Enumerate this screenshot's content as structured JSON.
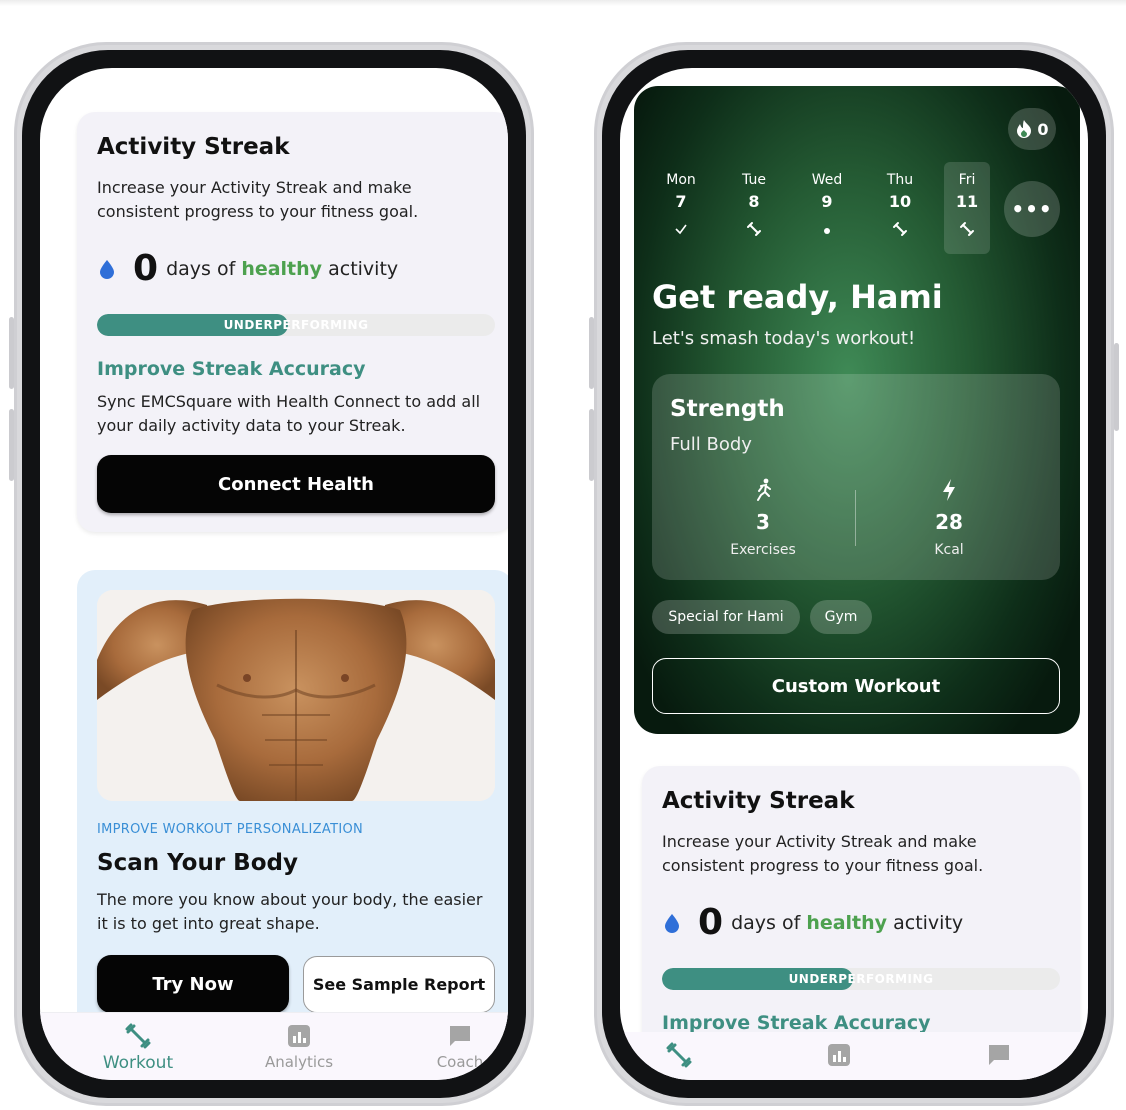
{
  "left": {
    "streak": {
      "title": "Activity Streak",
      "description": "Increase your Activity Streak and make consistent progress to your fitness goal.",
      "count": "0",
      "text_before": "days of",
      "text_highlight": "healthy",
      "text_after": "activity",
      "progress_label": "UNDERPERFORMING",
      "progress_fraction": 0.48,
      "improve_title": "Improve Streak Accuracy",
      "improve_desc": "Sync EMCSquare with Health Connect to add all your daily activity data to your Streak.",
      "connect_label": "Connect Health"
    },
    "scan": {
      "overline": "IMPROVE WORKOUT PERSONALIZATION",
      "title": "Scan Your Body",
      "description": "The more you know about your body, the easier it is to get into great shape.",
      "try_label": "Try Now",
      "sample_label": "See Sample Report"
    },
    "nav": {
      "workout": "Workout",
      "analytics": "Analytics",
      "coach": "Coach"
    }
  },
  "right": {
    "streak_chip": "0",
    "days": [
      {
        "name": "Mon",
        "num": "7",
        "icon": "check-icon"
      },
      {
        "name": "Tue",
        "num": "8",
        "icon": "dumbbell-icon"
      },
      {
        "name": "Wed",
        "num": "9",
        "icon": "dot-icon"
      },
      {
        "name": "Thu",
        "num": "10",
        "icon": "dumbbell-icon"
      },
      {
        "name": "Fri",
        "num": "11",
        "icon": "dumbbell-icon"
      }
    ],
    "more_label": "•••",
    "greeting": "Get ready, Hami",
    "greeting_sub": "Let's smash today's workout!",
    "workout": {
      "title": "Strength",
      "subtitle": "Full Body",
      "exercises_value": "3",
      "exercises_label": "Exercises",
      "kcal_value": "28",
      "kcal_label": "Kcal"
    },
    "tags": [
      "Special for Hami",
      "Gym"
    ],
    "custom_label": "Custom Workout",
    "streak": {
      "title": "Activity Streak",
      "description": "Increase your Activity Streak and make consistent progress to your fitness goal.",
      "count": "0",
      "text_before": "days of",
      "text_highlight": "healthy",
      "text_after": "activity",
      "progress_label": "UNDERPERFORMING",
      "progress_fraction": 0.48,
      "improve_title": "Improve Streak Accuracy"
    }
  },
  "colors": {
    "accent_teal": "#3e8f82",
    "healthy_green": "#4da14f",
    "overline_blue": "#3a8fd6",
    "hero_green": "#245a33"
  }
}
